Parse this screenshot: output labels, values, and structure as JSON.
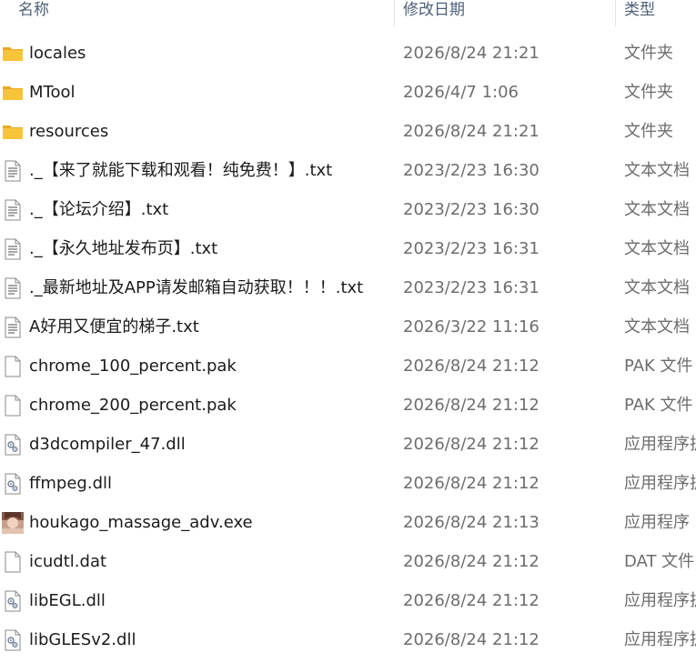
{
  "columns": {
    "name": "名称",
    "date": "修改日期",
    "type": "类型"
  },
  "files": [
    {
      "name": "locales",
      "date": "2026/8/24 21:21",
      "type": "文件夹",
      "icon": "folder-icon"
    },
    {
      "name": "MTool",
      "date": "2026/4/7 1:06",
      "type": "文件夹",
      "icon": "folder-icon"
    },
    {
      "name": "resources",
      "date": "2026/8/24 21:21",
      "type": "文件夹",
      "icon": "folder-icon"
    },
    {
      "name": "._【来了就能下载和观看！纯免费！】.txt",
      "date": "2023/2/23 16:30",
      "type": "文本文档",
      "icon": "text-file-icon"
    },
    {
      "name": "._【论坛介绍】.txt",
      "date": "2023/2/23 16:30",
      "type": "文本文档",
      "icon": "text-file-icon"
    },
    {
      "name": "._【永久地址发布页】.txt",
      "date": "2023/2/23 16:31",
      "type": "文本文档",
      "icon": "text-file-icon"
    },
    {
      "name": "._最新地址及APP请发邮箱自动获取！！！.txt",
      "date": "2023/2/23 16:31",
      "type": "文本文档",
      "icon": "text-file-icon"
    },
    {
      "name": "A好用又便宜的梯子.txt",
      "date": "2026/3/22 11:16",
      "type": "文本文档",
      "icon": "text-file-icon"
    },
    {
      "name": "chrome_100_percent.pak",
      "date": "2026/8/24 21:12",
      "type": "PAK 文件",
      "icon": "blank-file-icon"
    },
    {
      "name": "chrome_200_percent.pak",
      "date": "2026/8/24 21:12",
      "type": "PAK 文件",
      "icon": "blank-file-icon"
    },
    {
      "name": "d3dcompiler_47.dll",
      "date": "2026/8/24 21:12",
      "type": "应用程序扩展",
      "icon": "dll-file-icon"
    },
    {
      "name": "ffmpeg.dll",
      "date": "2026/8/24 21:12",
      "type": "应用程序扩展",
      "icon": "dll-file-icon"
    },
    {
      "name": "houkago_massage_adv.exe",
      "date": "2026/8/24 21:13",
      "type": "应用程序",
      "icon": "app-exe-icon"
    },
    {
      "name": "icudtl.dat",
      "date": "2026/8/24 21:12",
      "type": "DAT 文件",
      "icon": "blank-file-icon"
    },
    {
      "name": "libEGL.dll",
      "date": "2026/8/24 21:12",
      "type": "应用程序扩展",
      "icon": "dll-file-icon"
    },
    {
      "name": "libGLESv2.dll",
      "date": "2026/8/24 21:12",
      "type": "应用程序扩展",
      "icon": "dll-file-icon"
    }
  ],
  "colors": {
    "folder": "#f8c43a",
    "folder_dark": "#e9a822",
    "header_text": "#4c607a",
    "secondary_text": "#6d6d6d"
  }
}
